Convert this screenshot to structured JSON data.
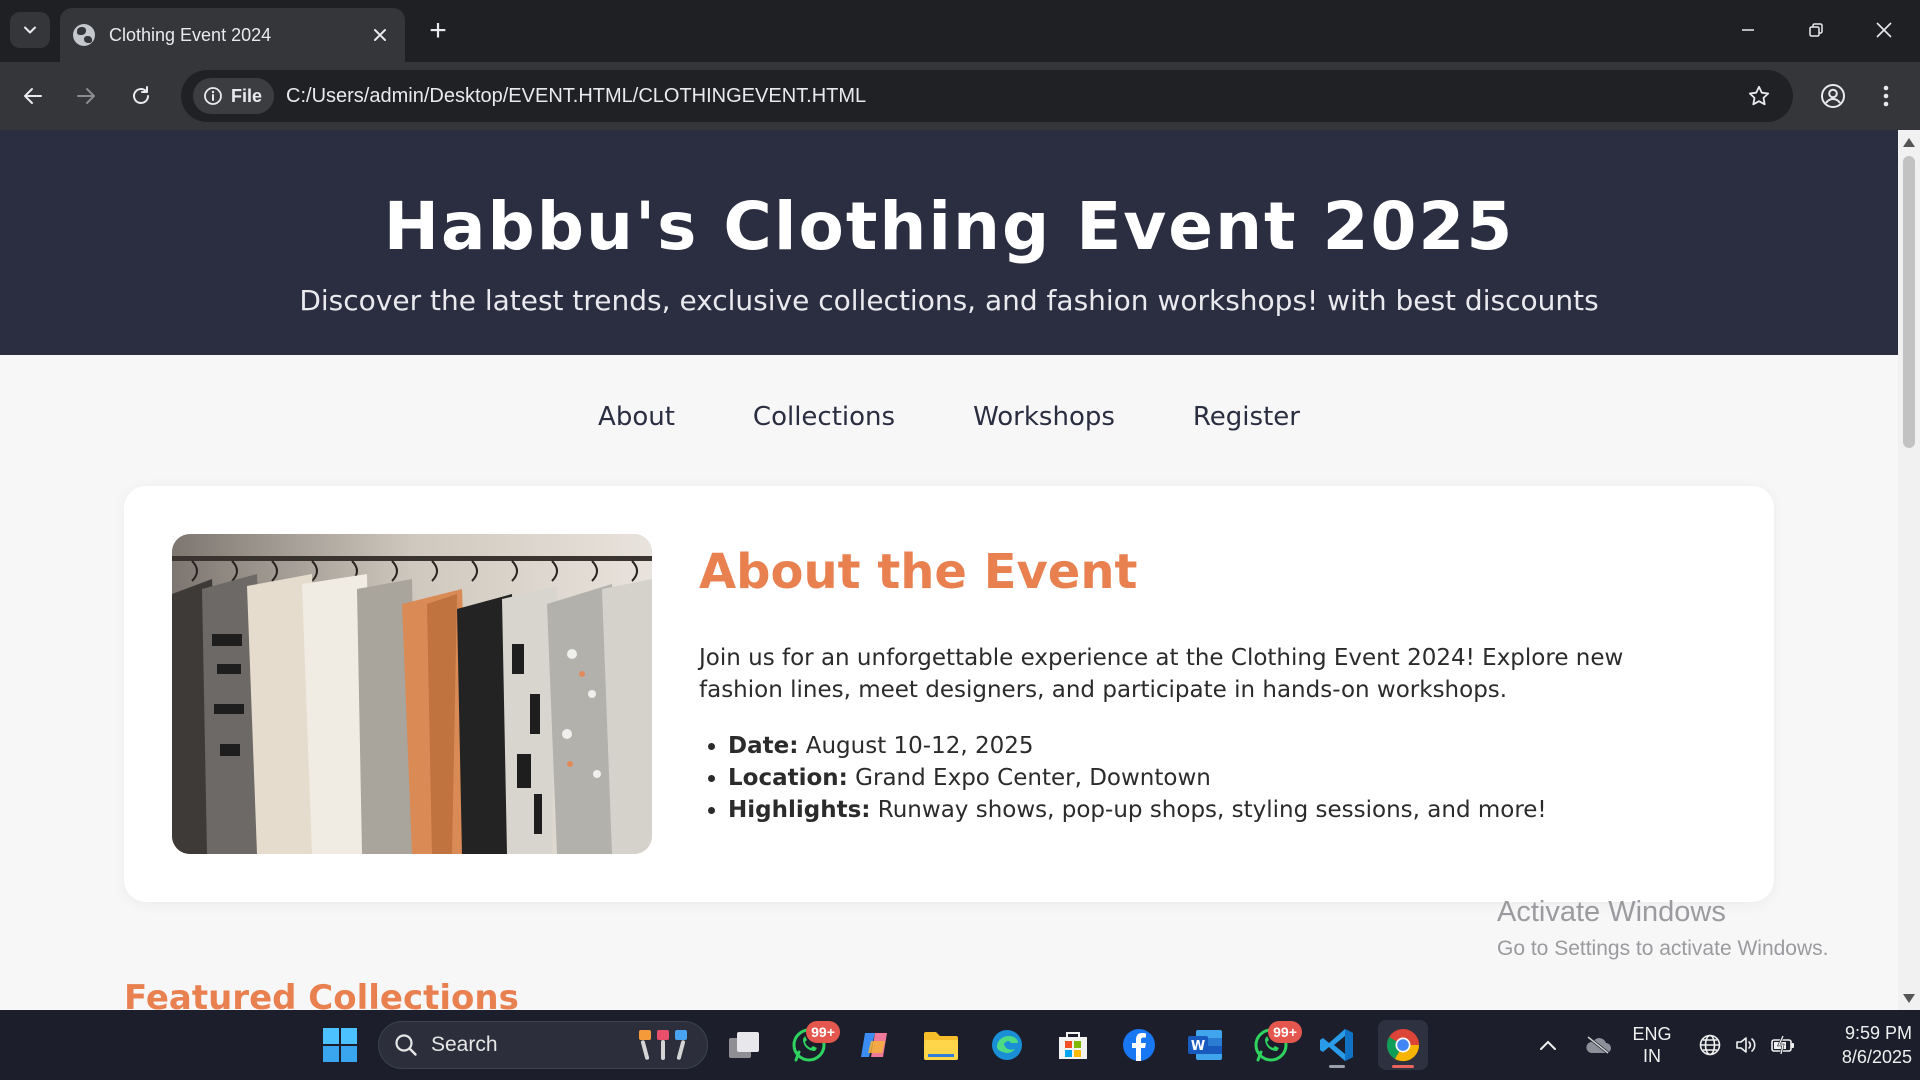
{
  "browser": {
    "tab_title": "Clothing Event 2024",
    "new_tab_symbol": "+",
    "site_info_label": "File",
    "url": "C:/Users/admin/Desktop/EVENT.HTML/CLOTHINGEVENT.HTML"
  },
  "page": {
    "hero_title": "Habbu's Clothing Event 2025",
    "hero_subtitle": "Discover the latest trends, exclusive collections, and fashion workshops! with best discounts",
    "nav": [
      "About",
      "Collections",
      "Workshops",
      "Register"
    ],
    "about": {
      "title": "About the Event",
      "description": "Join us for an unforgettable experience at the Clothing Event 2024! Explore new fashion lines, meet designers, and participate in hands-on workshops.",
      "details": [
        {
          "label": "Date:",
          "value": " August 10-12, 2025"
        },
        {
          "label": "Location:",
          "value": " Grand Expo Center, Downtown"
        },
        {
          "label": "Highlights:",
          "value": " Runway shows, pop-up shops, styling sessions, and more!"
        }
      ]
    },
    "featured_title": "Featured Collections"
  },
  "watermark": {
    "line1": "Activate Windows",
    "line2": "Go to Settings to activate Windows."
  },
  "taskbar": {
    "search_label": "Search",
    "whatsapp_badge": "99+",
    "whatsapp2_badge": "99+",
    "lang_line1": "ENG",
    "lang_line2": "IN",
    "time": "9:59 PM",
    "date": "8/6/2025"
  },
  "colors": {
    "hero_bg": "#2a2e40",
    "accent": "#e8804f",
    "browser_dark": "#1f2024",
    "toolbar": "#35363a"
  }
}
